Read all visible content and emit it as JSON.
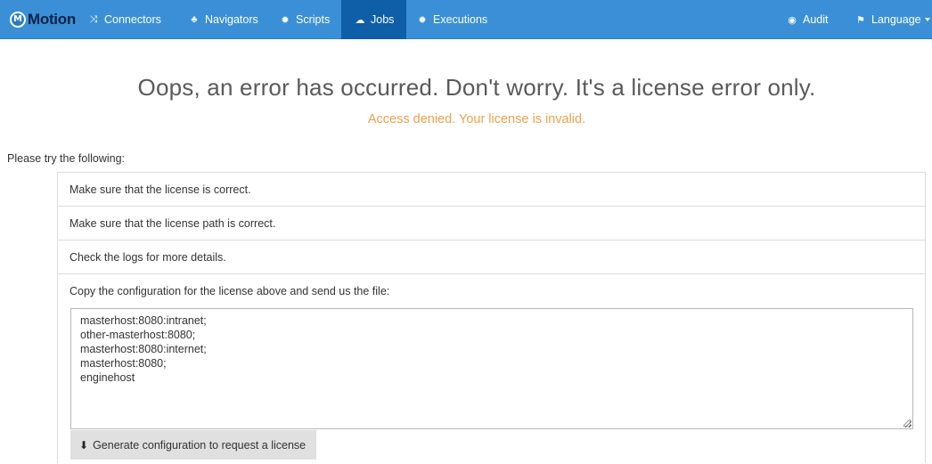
{
  "brand": {
    "logo_letter": "M",
    "name": "Motion"
  },
  "nav": {
    "items": [
      {
        "label": "Connectors",
        "icon": "shuffle-icon",
        "glyph": "⤨"
      },
      {
        "label": "Navigators",
        "icon": "sitemap-icon",
        "glyph": "♣"
      },
      {
        "label": "Scripts",
        "icon": "cog-icon",
        "glyph": "✹"
      },
      {
        "label": "Jobs",
        "icon": "cloud-icon",
        "glyph": "☁",
        "active": true
      },
      {
        "label": "Executions",
        "icon": "cog-icon",
        "glyph": "✹"
      }
    ],
    "right": [
      {
        "label": "Audit",
        "icon": "eye-icon",
        "glyph": "◉"
      },
      {
        "label": "Language",
        "icon": "flag-icon",
        "glyph": "⚑"
      }
    ]
  },
  "error": {
    "title": "Oops, an error has occurred. Don't worry. It's a license error only.",
    "subtitle": "Access denied. Your license is invalid."
  },
  "instructions": {
    "label": "Please try the following:",
    "items": [
      "Make sure that the license is correct.",
      "Make sure that the license path is correct.",
      "Check the logs for more details.",
      "Copy the configuration for the license above and send us the file:"
    ]
  },
  "config": {
    "lines": [
      "masterhost:8080:intranet;",
      "other-masterhost:8080;",
      "masterhost:8080:internet;",
      "masterhost:8080;",
      "enginehost"
    ]
  },
  "generate_button": {
    "label": "Generate configuration to request a license",
    "icon": "download-icon",
    "glyph": "⬇"
  },
  "colors": {
    "navbar": "#3a8fd7",
    "nav_active": "#0e5ea8",
    "error_subtitle": "#f0a04b"
  }
}
